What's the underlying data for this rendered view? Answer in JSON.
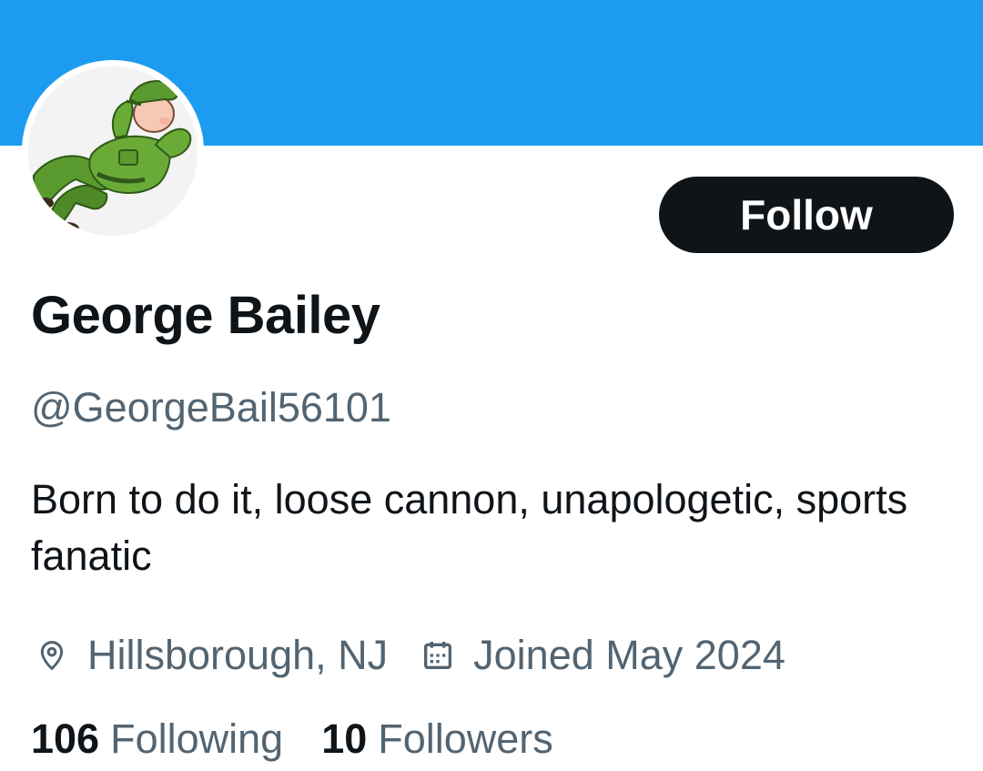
{
  "profile": {
    "display_name": "George Bailey",
    "handle": "@GeorgeBail56101",
    "bio": "Born to do it, loose cannon, unapologetic, sports fanatic",
    "location": "Hillsborough, NJ",
    "joined": "Joined May 2024",
    "avatar_description": "cartoon soldier in green uniform lying back with hands behind head"
  },
  "actions": {
    "follow_label": "Follow"
  },
  "stats": {
    "following_count": "106",
    "following_label": "Following",
    "followers_count": "10",
    "followers_label": "Followers"
  },
  "icons": {
    "location": "location-pin-icon",
    "joined": "calendar-icon"
  },
  "colors": {
    "banner": "#1d9bf0",
    "primary_text": "#0f1419",
    "secondary_text": "#536471",
    "follow_button_bg": "#0f1419",
    "follow_button_text": "#ffffff"
  }
}
